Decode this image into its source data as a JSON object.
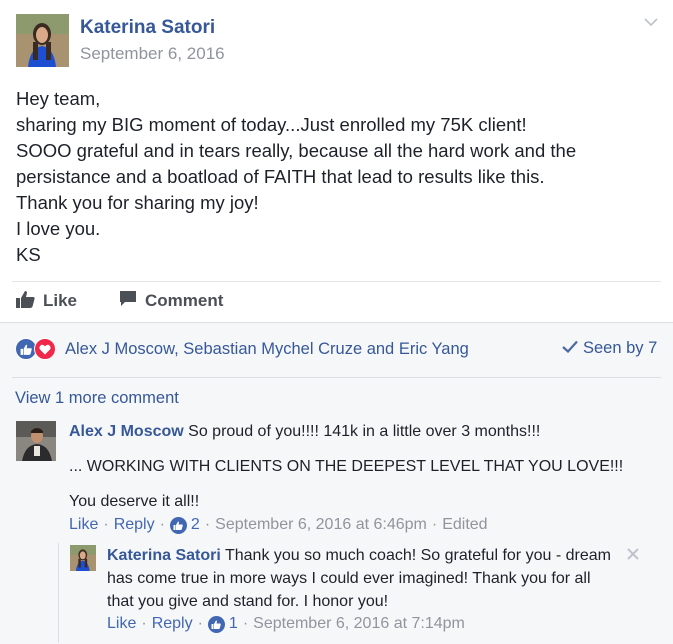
{
  "post": {
    "author": "Katerina Satori",
    "date": "September 6, 2016",
    "lines": [
      "Hey team,",
      "sharing my BIG moment of today...Just enrolled my 75K client!",
      "SOOO grateful and in tears really, because all the hard work and the",
      "persistance and a boatload of FAITH that lead to results like this.",
      "Thank you for sharing my joy!",
      "I love you.",
      "KS"
    ]
  },
  "actions": {
    "like_label": "Like",
    "comment_label": "Comment"
  },
  "reactions": {
    "names": "Alex J Moscow, Sebastian Mychel Cruze and Eric Yang",
    "seen_by": "Seen by 7"
  },
  "comments": {
    "view_more": "View 1 more comment",
    "items": [
      {
        "author": "Alex J Moscow",
        "lines": [
          "So proud of you!!!! 141k in a little over 3 months!!!",
          "... WORKING WITH CLIENTS ON THE DEEPEST LEVEL THAT YOU LOVE!!!",
          "You deserve it all!!"
        ],
        "like_label": "Like",
        "reply_label": "Reply",
        "like_count": "2",
        "timestamp": "September 6, 2016 at 6:46pm",
        "edited": "Edited"
      },
      {
        "author": "Katerina Satori",
        "lines": [
          "Thank you so much coach! So grateful for you - dream",
          "has come true in more ways I could ever imagined! Thank you for all",
          "that you give and stand for. I honor you!"
        ],
        "like_label": "Like",
        "reply_label": "Reply",
        "like_count": "1",
        "timestamp": "September 6, 2016 at 7:14pm"
      }
    ]
  },
  "colors": {
    "link": "#365899",
    "brand_blue": "#4267b2",
    "love_red": "#f0284a",
    "meta_gray": "#90949c",
    "comment_bg": "#f6f7f9"
  },
  "icons": [
    "chevron-down-icon",
    "thumbs-up-icon",
    "speech-bubble-icon",
    "like-reaction-icon",
    "love-reaction-icon",
    "checkmark-icon",
    "close-icon"
  ]
}
